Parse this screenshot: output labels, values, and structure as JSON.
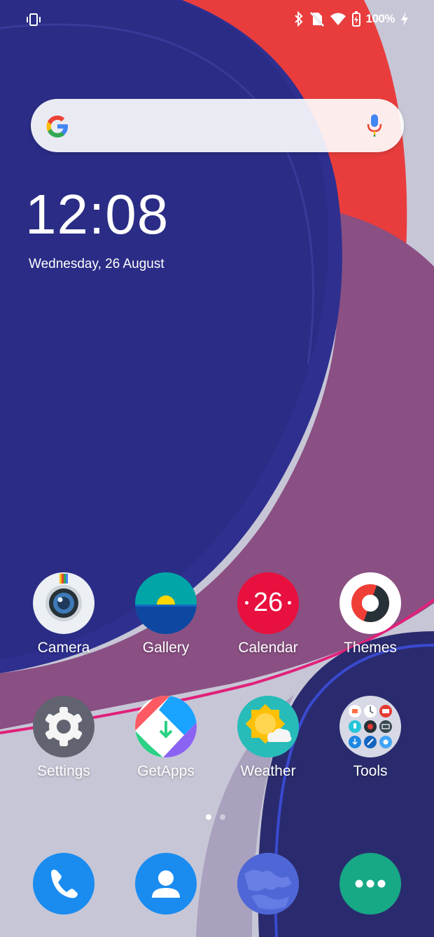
{
  "status": {
    "battery_percent": "100%"
  },
  "clock": {
    "time": "12:08",
    "date": "Wednesday, 26 August"
  },
  "apps_row1": [
    {
      "label": "Camera"
    },
    {
      "label": "Gallery"
    },
    {
      "label": "Calendar",
      "badge": "26"
    },
    {
      "label": "Themes"
    }
  ],
  "apps_row2": [
    {
      "label": "Settings"
    },
    {
      "label": "GetApps"
    },
    {
      "label": "Weather"
    },
    {
      "label": "Tools"
    }
  ],
  "pager": {
    "current": 1,
    "count": 2
  },
  "colors": {
    "phone_blue": "#1a8cf0",
    "messages_teal": "#17a886",
    "calendar_red": "#e8103e",
    "weather_teal": "#27bcb9"
  }
}
